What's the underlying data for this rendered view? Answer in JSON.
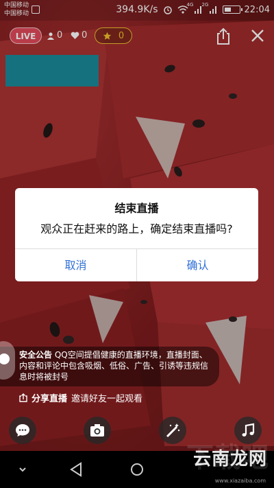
{
  "status_bar": {
    "carrier_1": "中国移动",
    "carrier_2": "中国移动",
    "speed": "394.9K/s",
    "signal_1_label": "4G",
    "signal_2_label": "2G",
    "time": "22:04"
  },
  "live_header": {
    "live_label": "LIVE",
    "viewers": "0",
    "likes": "0",
    "stars": "0"
  },
  "dialog": {
    "title": "结束直播",
    "message": "观众正在赶来的路上，确定结束直播吗?",
    "cancel_label": "取消",
    "confirm_label": "确认"
  },
  "notice": {
    "tag": "安全公告",
    "text": "QQ空间提倡健康的直播环境，直播封面、内容和评论中包含吸烟、低俗、广告、引诱等违规信息时将被封号"
  },
  "share_hint": {
    "bold": "分享直播",
    "text": "邀请好友一起观看"
  },
  "toolbar": {
    "icons": [
      "comment-icon",
      "camera-icon",
      "magic-wand-icon",
      "music-icon"
    ]
  },
  "watermark": {
    "text": "云南龙网",
    "bg_text": "下载吧",
    "sub": "www.xiazaiba.com"
  },
  "colors": {
    "live_badge": "#e24a5b",
    "star": "#f0c030",
    "dialog_button": "#2f6fd6",
    "teal_block": "#1b8a9a"
  }
}
